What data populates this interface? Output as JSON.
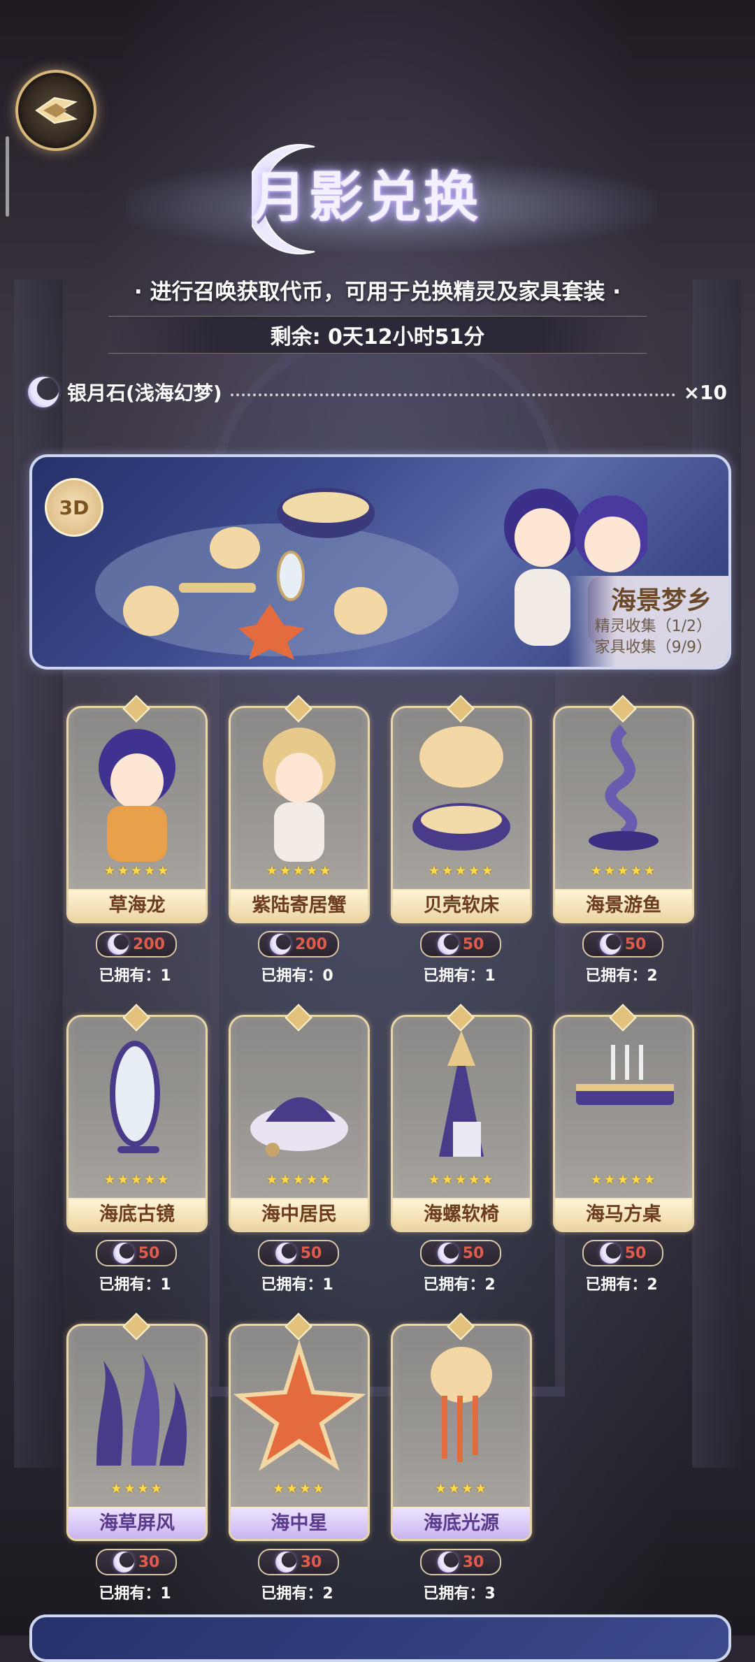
{
  "header": {
    "title": "月影兑换",
    "subtitle": "· 进行召唤获取代币，可用于兑换精灵及家具套装 ·",
    "timer": "剩余: 0天12小时51分"
  },
  "currency": {
    "name": "银月石(浅海幻梦)",
    "count": "×10",
    "icon": "crescent-moon-icon"
  },
  "banner": {
    "badge": "3D",
    "set_name": "海景梦乡",
    "spirit_collect": "精灵收集（1/2）",
    "furniture_collect": "家具收集（9/9）"
  },
  "items": [
    {
      "name": "草海龙",
      "price": "200",
      "owned": "已拥有：1",
      "stars": "★★★★★",
      "rarity": "gold"
    },
    {
      "name": "紫陆寄居蟹",
      "price": "200",
      "owned": "已拥有：0",
      "stars": "★★★★★",
      "rarity": "gold"
    },
    {
      "name": "贝壳软床",
      "price": "50",
      "owned": "已拥有：1",
      "stars": "★★★★★",
      "rarity": "gold"
    },
    {
      "name": "海景游鱼",
      "price": "50",
      "owned": "已拥有：2",
      "stars": "★★★★★",
      "rarity": "gold"
    },
    {
      "name": "海底古镜",
      "price": "50",
      "owned": "已拥有：1",
      "stars": "★★★★★",
      "rarity": "gold"
    },
    {
      "name": "海中居民",
      "price": "50",
      "owned": "已拥有：1",
      "stars": "★★★★★",
      "rarity": "gold"
    },
    {
      "name": "海螺软椅",
      "price": "50",
      "owned": "已拥有：2",
      "stars": "★★★★★",
      "rarity": "gold"
    },
    {
      "name": "海马方桌",
      "price": "50",
      "owned": "已拥有：2",
      "stars": "★★★★★",
      "rarity": "gold"
    },
    {
      "name": "海草屏风",
      "price": "30",
      "owned": "已拥有：1",
      "stars": "★★★★",
      "rarity": "purple"
    },
    {
      "name": "海中星",
      "price": "30",
      "owned": "已拥有：2",
      "stars": "★★★★",
      "rarity": "purple"
    },
    {
      "name": "海底光源",
      "price": "30",
      "owned": "已拥有：3",
      "stars": "★★★★",
      "rarity": "purple"
    }
  ],
  "colors": {
    "price": "#e35b4a",
    "gold_plate": "#ecd5a2",
    "purple_plate": "#c9b5f0",
    "star": "#ffd84c"
  }
}
